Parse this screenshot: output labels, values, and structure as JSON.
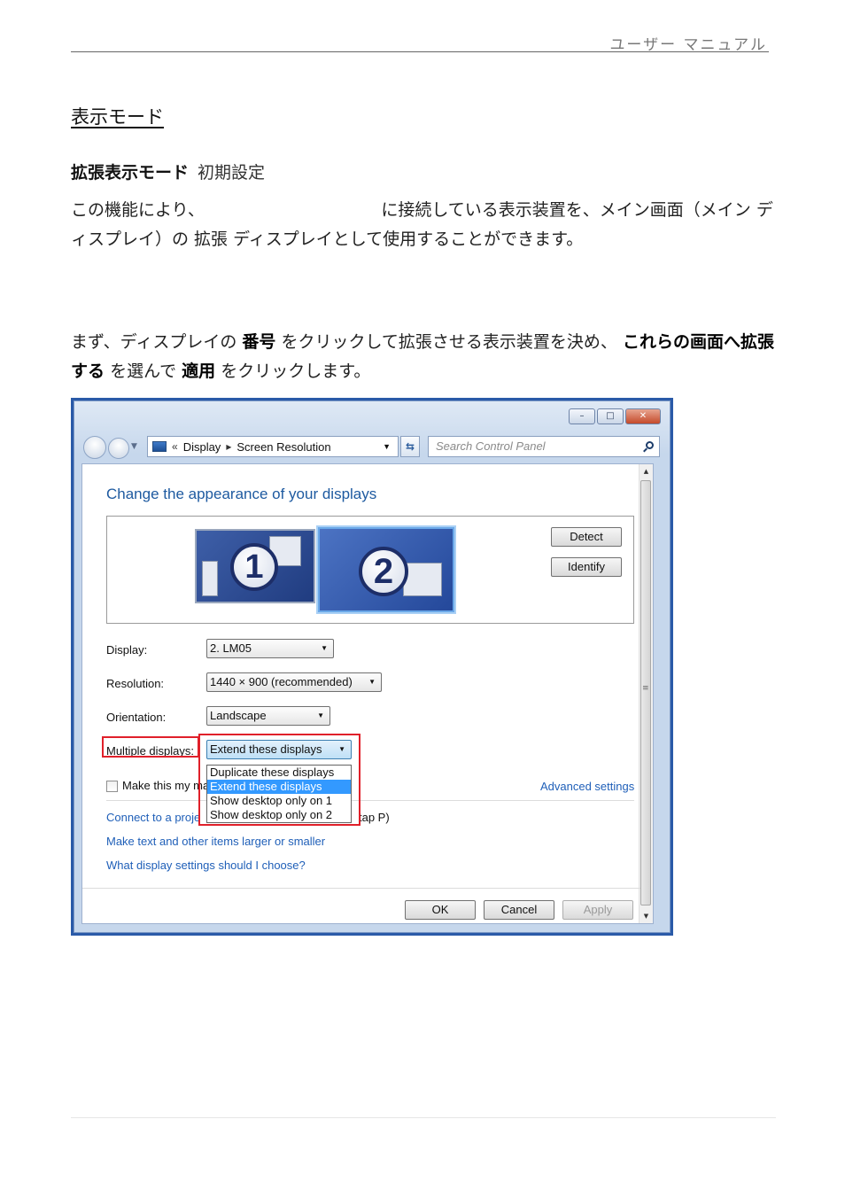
{
  "page": {
    "header": "ユーザー マニュアル",
    "title": "表示モード",
    "subtitle_bold": "拡張表示モード",
    "subtitle_normal": "初期設定",
    "para1": "この機能により、　　　　　　　　　　　に接続している表示装置を、メイン画面（メイン ディスプレイ）の 拡張 ディスプレイとして使用することができます。",
    "para2_a": "まず、ディスプレイの",
    "para2_b": "番号",
    "para2_c": "をクリックして拡張させる表示装置を決め、",
    "para2_d": "これらの画面へ拡張する",
    "para2_e": "を選んで",
    "para2_f": "適用",
    "para2_g": "をクリックします。"
  },
  "screenshot": {
    "breadcrumb": {
      "prefix": "«",
      "item1": "Display",
      "item2": "Screen Resolution"
    },
    "search_placeholder": "Search Control Panel",
    "heading": "Change the appearance of your displays",
    "monitors": [
      "1",
      "2"
    ],
    "detect": "Detect",
    "identify": "Identify",
    "display_label": "Display:",
    "display_value": "2. LM05",
    "resolution_label": "Resolution:",
    "resolution_value": "1440 × 900 (recommended)",
    "orientation_label": "Orientation:",
    "orientation_value": "Landscape",
    "multiple_label": "Multiple displays:",
    "multiple_value": "Extend these displays",
    "options": [
      "Duplicate these displays",
      "Extend these displays",
      "Show desktop only on 1",
      "Show desktop only on 2"
    ],
    "checkbox_label": "Make this my ma",
    "advanced": "Advanced settings",
    "link_connect_a": "Connect to a proje",
    "link_connect_b": "tap P)",
    "link_text_size": "Make text and other items larger or smaller",
    "link_help": "What display settings should I choose?",
    "ok": "OK",
    "cancel": "Cancel",
    "apply": "Apply",
    "window_controls": {
      "minimize": "–",
      "maximize": "□",
      "close": "✕"
    }
  }
}
